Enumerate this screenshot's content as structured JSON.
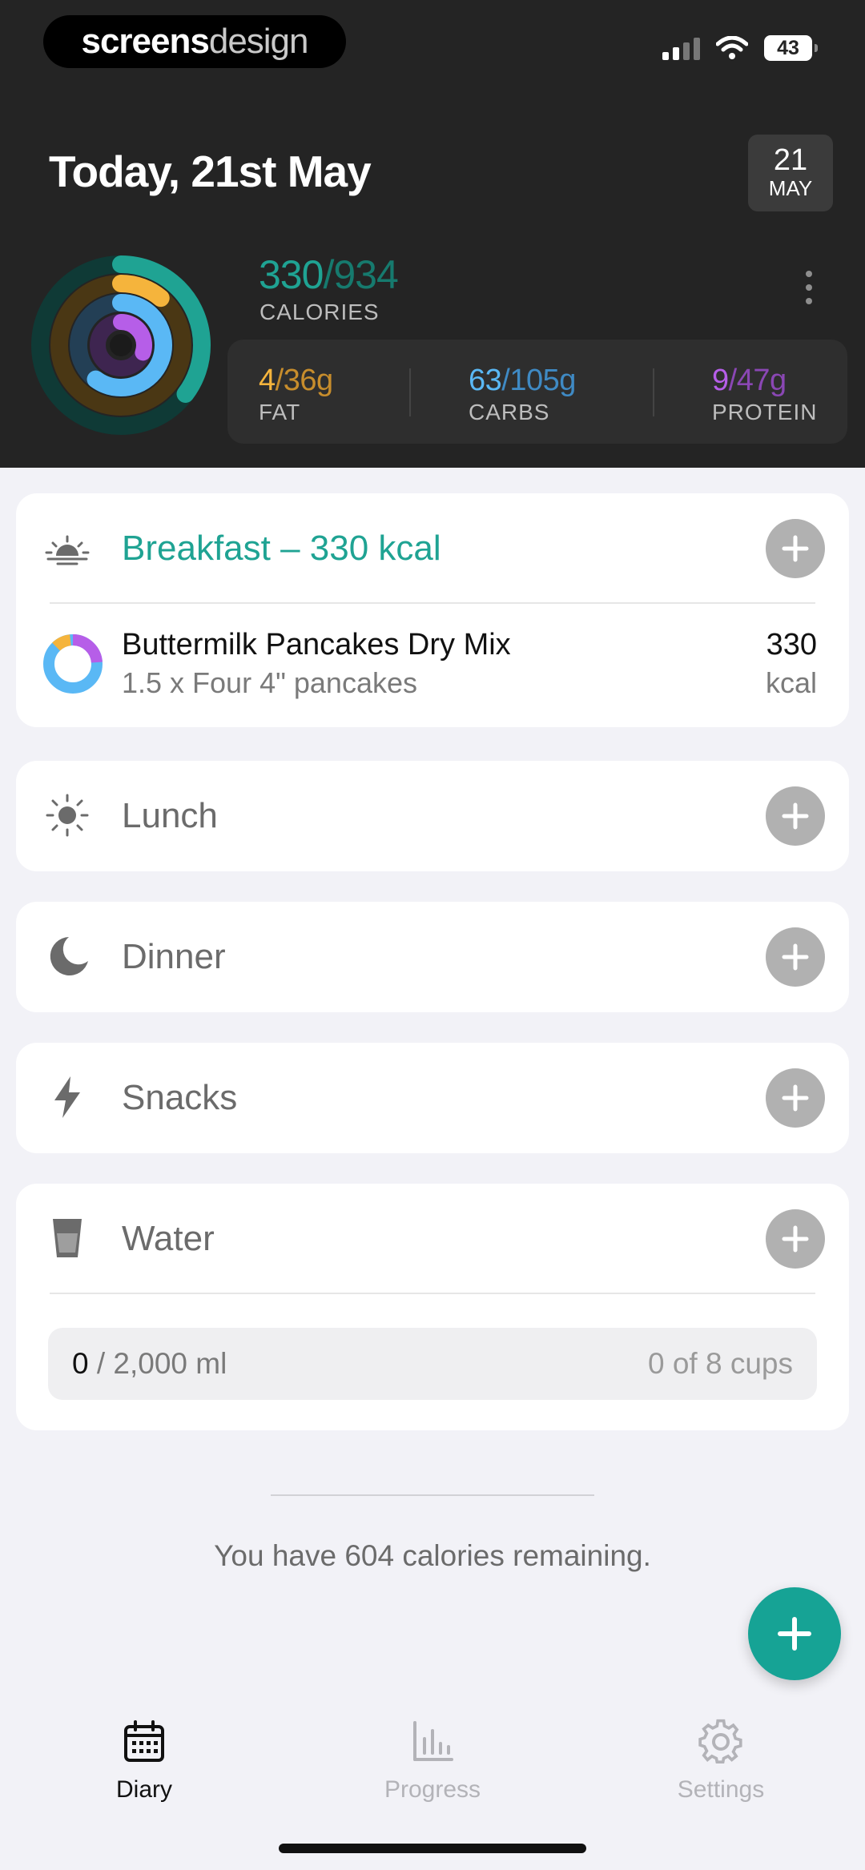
{
  "status_bar": {
    "brand_main": "screens",
    "brand_sub": "design",
    "battery": "43"
  },
  "header": {
    "title": "Today, 21st May",
    "date_day": "21",
    "date_month": "MAY",
    "calories_current": "330",
    "calories_goal": "/934",
    "calories_label": "CALORIES",
    "macros": [
      {
        "current": "4",
        "goal": "/36g",
        "label": "FAT",
        "color": "#f5b43c",
        "goal_color": "#c78d2c"
      },
      {
        "current": "63",
        "goal": "/105g",
        "label": "CARBS",
        "color": "#5ab8f5",
        "goal_color": "#3f8ac4"
      },
      {
        "current": "9",
        "goal": "/47g",
        "label": "PROTEIN",
        "color": "#b65ee8",
        "goal_color": "#8a47b4"
      }
    ]
  },
  "meals": {
    "breakfast": {
      "label": "Breakfast – 330 kcal",
      "icon": "sunrise-icon",
      "item": {
        "name": "Buttermilk Pancakes Dry Mix",
        "serving": "1.5 x Four 4\" pancakes",
        "kcal": "330",
        "unit": "kcal"
      }
    },
    "lunch": {
      "label": "Lunch",
      "icon": "sun-icon"
    },
    "dinner": {
      "label": "Dinner",
      "icon": "moon-icon"
    },
    "snacks": {
      "label": "Snacks",
      "icon": "lightning-icon"
    },
    "water": {
      "label": "Water",
      "icon": "glass-icon",
      "current": "0",
      "goal": " / 2,000 ml",
      "cups": "0 of 8 cups"
    }
  },
  "remaining_text": "You have 604 calories remaining.",
  "tabs": [
    {
      "label": "Diary",
      "icon": "calendar-icon",
      "active": true
    },
    {
      "label": "Progress",
      "icon": "bar-chart-icon",
      "active": false
    },
    {
      "label": "Settings",
      "icon": "gear-icon",
      "active": false
    }
  ],
  "colors": {
    "accent": "#16a395",
    "header_bg": "#242424",
    "fat": "#f5b43c",
    "carbs": "#5ab8f5",
    "protein": "#b65ee8"
  }
}
